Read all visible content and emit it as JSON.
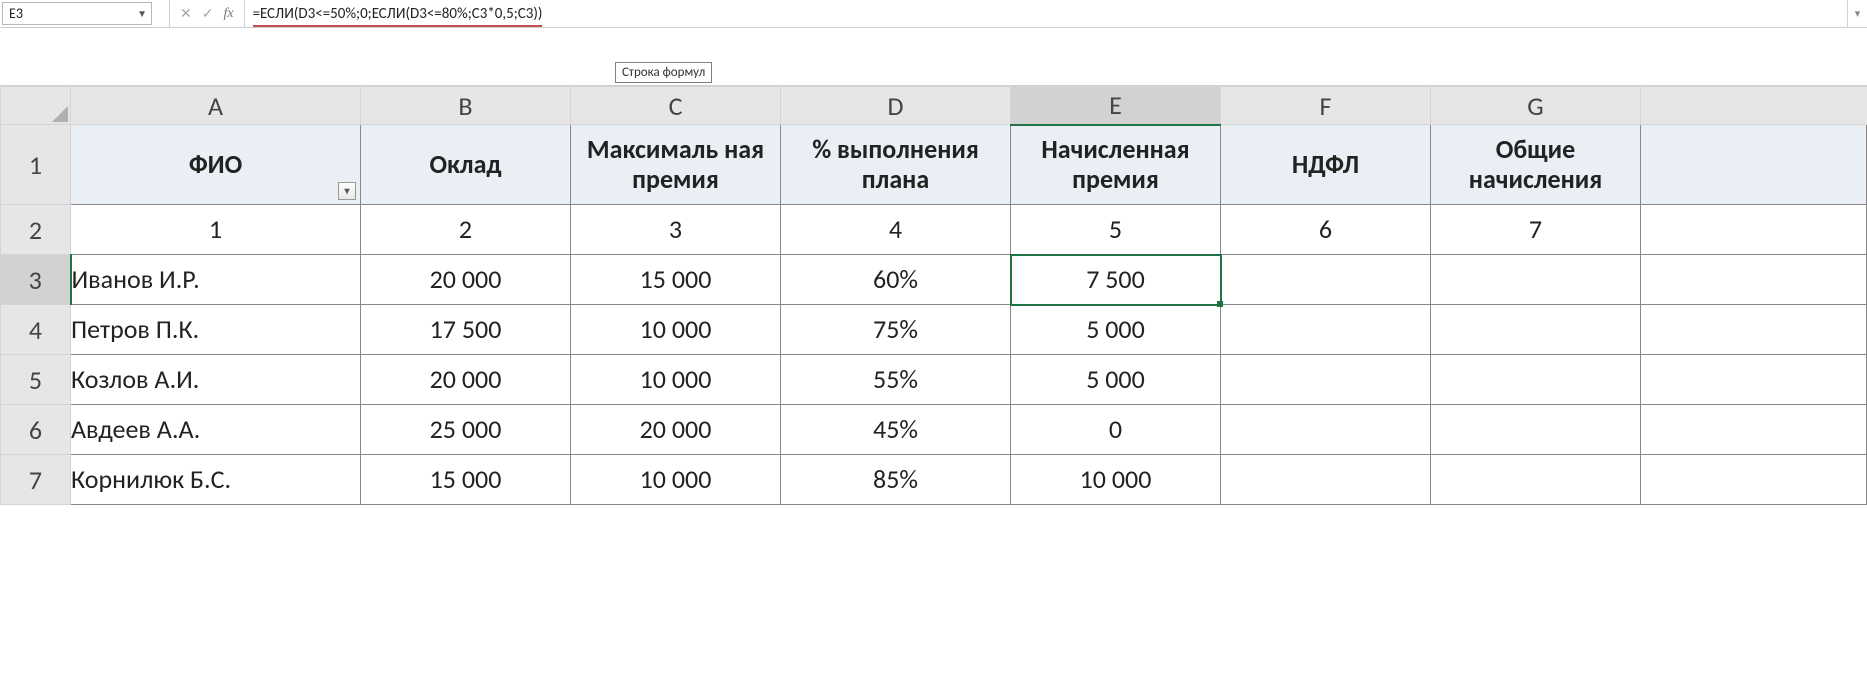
{
  "name_box": {
    "value": "E3"
  },
  "formula_bar": {
    "fx_label": "fx",
    "cancel_icon": "✕",
    "enter_icon": "✓",
    "formula": "=ЕСЛИ(D3<=50%;0;ЕСЛИ(D3<=80%;C3*0,5;C3))"
  },
  "tooltip": "Строка формул",
  "columns": [
    "A",
    "B",
    "C",
    "D",
    "E",
    "F",
    "G"
  ],
  "row_numbers": [
    "1",
    "2",
    "3",
    "4",
    "5",
    "6",
    "7"
  ],
  "selected": {
    "col": "E",
    "row": "3"
  },
  "table": {
    "headers": {
      "A": "ФИО",
      "B": "Оклад",
      "C": "Максималь\nная премия",
      "D": "% выполнения плана",
      "E": "Начисленная премия",
      "F": "НДФЛ",
      "G": "Общие начисления"
    },
    "index_row": {
      "A": "1",
      "B": "2",
      "C": "3",
      "D": "4",
      "E": "5",
      "F": "6",
      "G": "7"
    },
    "rows": [
      {
        "A": "Иванов И.Р.",
        "B": "20 000",
        "C": "15 000",
        "D": "60%",
        "E": "7 500",
        "F": "",
        "G": ""
      },
      {
        "A": "Петров П.К.",
        "B": "17 500",
        "C": "10 000",
        "D": "75%",
        "E": "5 000",
        "F": "",
        "G": ""
      },
      {
        "A": "Козлов А.И.",
        "B": "20 000",
        "C": "10 000",
        "D": "55%",
        "E": "5 000",
        "F": "",
        "G": ""
      },
      {
        "A": "Авдеев А.А.",
        "B": "25 000",
        "C": "20 000",
        "D": "45%",
        "E": "0",
        "F": "",
        "G": ""
      },
      {
        "A": "Корнилюк Б.С.",
        "B": "15 000",
        "C": "10 000",
        "D": "85%",
        "E": "10 000",
        "F": "",
        "G": ""
      }
    ]
  }
}
